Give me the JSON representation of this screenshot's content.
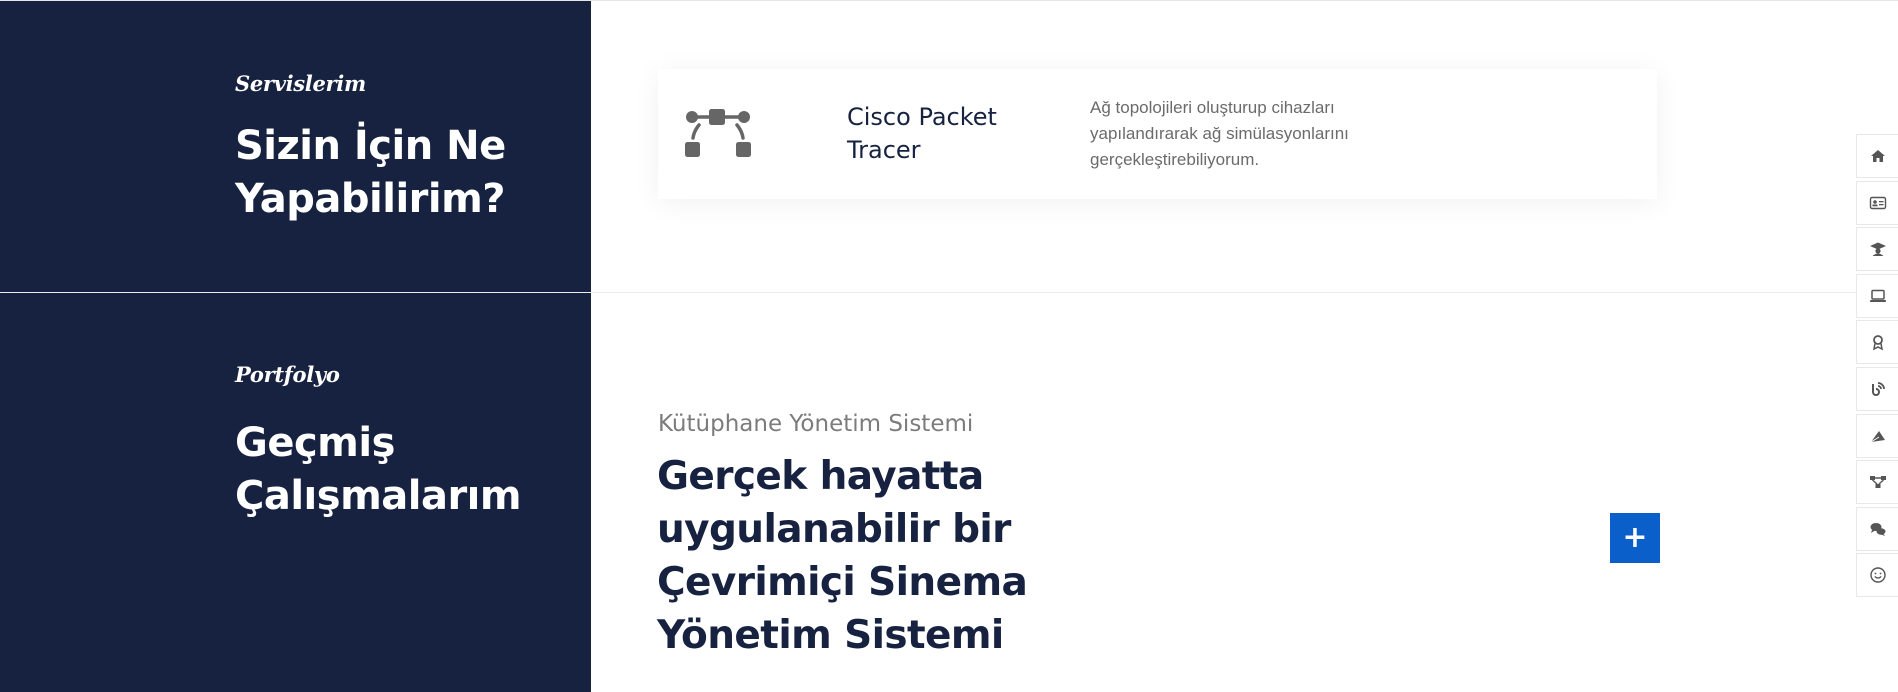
{
  "services": {
    "eyebrow": "Servislerim",
    "title_line1": "Sizin İçin Ne",
    "title_line2": "Yapabilirim?",
    "card": {
      "icon": "network-topology-icon",
      "title": "Cisco Packet Tracer",
      "description": "Ağ topolojileri oluşturup cihazları yapılandırarak ağ simülasyonlarını gerçekleştirebiliyorum."
    }
  },
  "portfolio": {
    "eyebrow": "Portfolyo",
    "title_line1": "Geçmiş",
    "title_line2": "Çalışmalarım",
    "item": {
      "subtitle": "Kütüphane Yönetim Sistemi",
      "heading": "Gerçek hayatta uygulanabilir bir Çevrimiçi Sinema Yönetim Sistemi",
      "action_label": "+"
    }
  },
  "side_nav": {
    "items": [
      {
        "icon": "home-icon"
      },
      {
        "icon": "id-card-icon"
      },
      {
        "icon": "graduation-cap-icon"
      },
      {
        "icon": "laptop-icon"
      },
      {
        "icon": "award-icon"
      },
      {
        "icon": "blog-icon"
      },
      {
        "icon": "paper-plane-icon"
      },
      {
        "icon": "network-icon"
      },
      {
        "icon": "comments-icon"
      },
      {
        "icon": "smile-icon"
      }
    ]
  },
  "colors": {
    "navy": "#16223f",
    "accent_blue": "#0b5fcb",
    "muted_text": "#6b6b6b",
    "icon_gray": "#666666"
  }
}
